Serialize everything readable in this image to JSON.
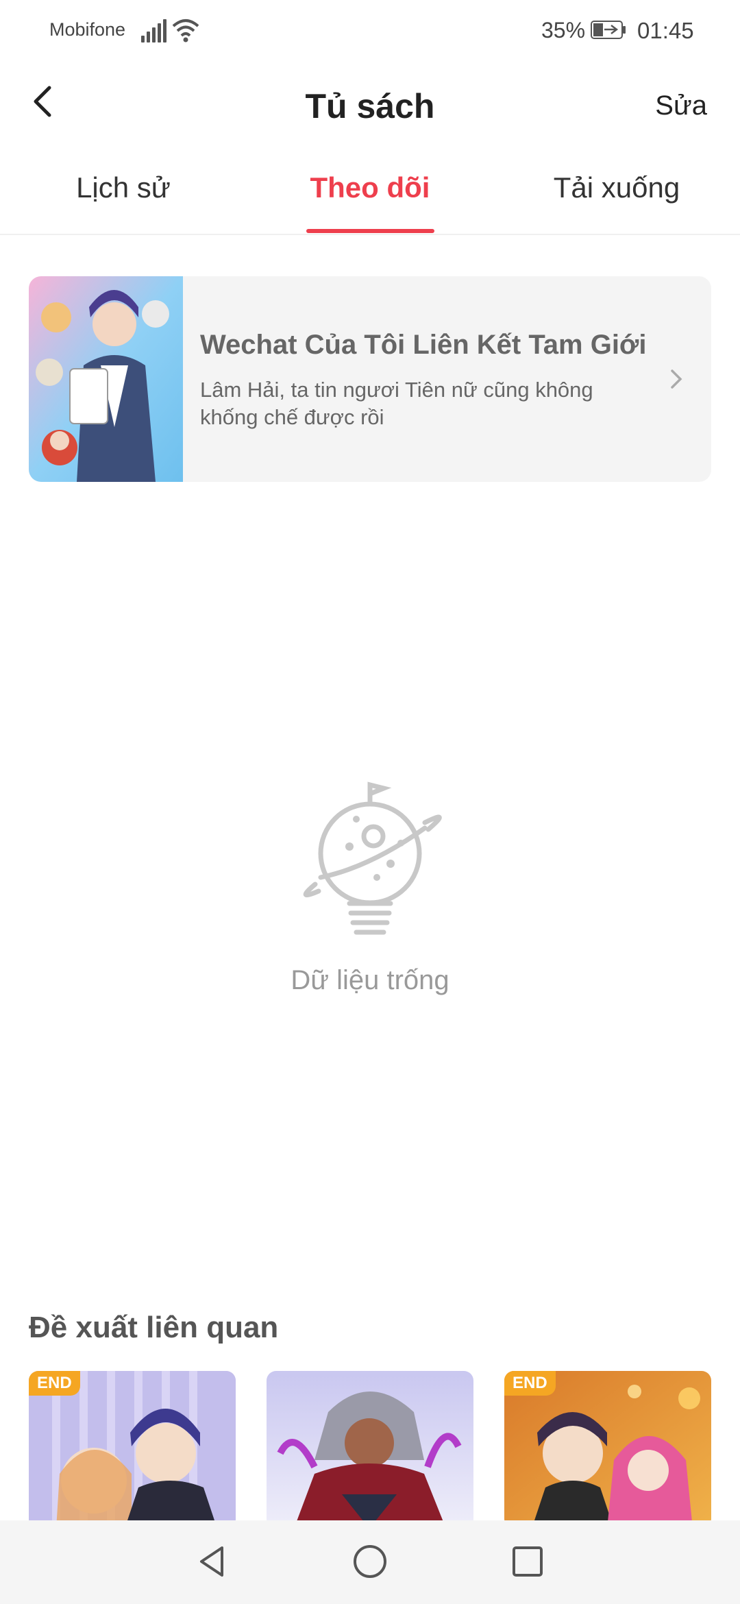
{
  "status_bar": {
    "carrier": "Mobifone",
    "battery_percent": "35%",
    "time": "01:45"
  },
  "header": {
    "title": "Tủ sách",
    "edit_label": "Sửa",
    "back_icon": "back-arrow-icon"
  },
  "tabs": [
    {
      "label": "Lịch sử",
      "active": false
    },
    {
      "label": "Theo dõi",
      "active": true
    },
    {
      "label": "Tải xuống",
      "active": false
    }
  ],
  "followed": {
    "title": "Wechat Của Tôi Liên Kết Tam Giới",
    "description": "Lâm Hải, ta tin ngươi Tiên nữ cũng không khống chế được rồi"
  },
  "empty_state": {
    "text": "Dữ liệu trống",
    "icon": "planet-bulb-icon"
  },
  "recommendations": {
    "title": "Đề xuất liên quan",
    "items": [
      {
        "badge": "END"
      },
      {
        "badge": ""
      },
      {
        "badge": "END"
      }
    ]
  },
  "colors": {
    "accent": "#ee3f4d",
    "badge": "#f5a623"
  }
}
